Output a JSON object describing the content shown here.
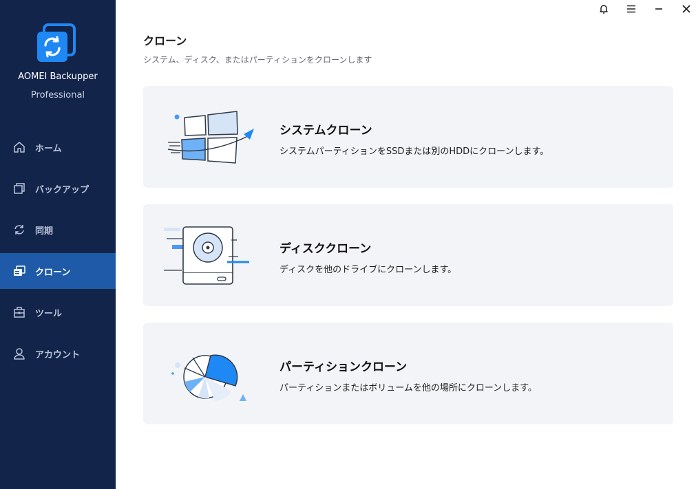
{
  "app": {
    "name": "AOMEI Backupper",
    "edition": "Professional"
  },
  "titlebar": {
    "icons": [
      "bell-icon",
      "menu-icon",
      "minimize-icon",
      "close-icon"
    ]
  },
  "sidebar": {
    "items": [
      {
        "label": "ホーム",
        "icon": "home-icon",
        "active": false
      },
      {
        "label": "バックアップ",
        "icon": "backup-icon",
        "active": false
      },
      {
        "label": "同期",
        "icon": "sync-icon",
        "active": false
      },
      {
        "label": "クローン",
        "icon": "clone-icon",
        "active": true
      },
      {
        "label": "ツール",
        "icon": "toolbox-icon",
        "active": false
      },
      {
        "label": "アカウント",
        "icon": "user-icon",
        "active": false
      }
    ]
  },
  "main": {
    "title": "クローン",
    "subtitle": "システム、ディスク、またはパーティションをクローンします",
    "cards": [
      {
        "title": "システムクローン",
        "description": "システムパーティションをSSDまたは別のHDDにクローンします。",
        "icon": "system-clone-illustration"
      },
      {
        "title": "ディスククローン",
        "description": "ディスクを他のドライブにクローンします。",
        "icon": "disk-clone-illustration"
      },
      {
        "title": "パーティションクローン",
        "description": "パーティションまたはボリュームを他の場所にクローンします。",
        "icon": "partition-clone-illustration"
      }
    ]
  },
  "colors": {
    "sidebar_bg": "#13244a",
    "active_nav": "#1f5aa8",
    "accent": "#1e88f5",
    "card_bg": "#f3f4f7"
  }
}
